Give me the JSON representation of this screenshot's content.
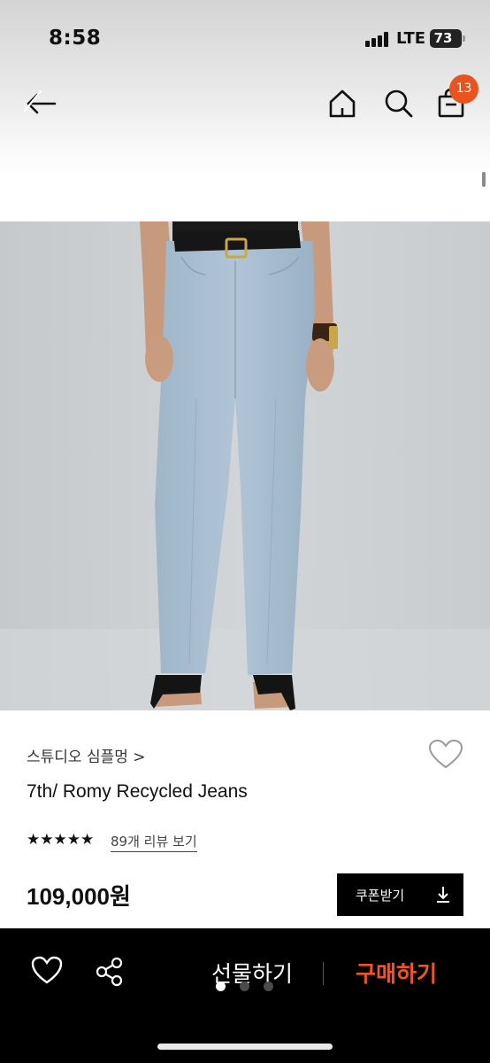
{
  "status_bar": {
    "time": "8:58",
    "network": "LTE",
    "battery": "73"
  },
  "nav": {
    "icons": [
      "back-arrow-icon",
      "home-icon",
      "search-icon",
      "shopping-bag-icon"
    ],
    "cart_count": "13",
    "badge_color": "#e8531e"
  },
  "product": {
    "image": "light-wash straight jeans on model, black belt, black sandals",
    "brand": "스튜디오 심플멍 >",
    "name": "7th/ Romy Recycled Jeans",
    "stars": "★★★★★",
    "rating": 5,
    "review_link": "89개 리뷰 보기",
    "price": "109,000원",
    "coupon_label": "쿠폰받기"
  },
  "bottom_bar": {
    "gift_label": "선물하기",
    "buy_label": "구매하기",
    "buy_color": "#f2541b",
    "carousel_total": 3,
    "carousel_active": 1
  }
}
